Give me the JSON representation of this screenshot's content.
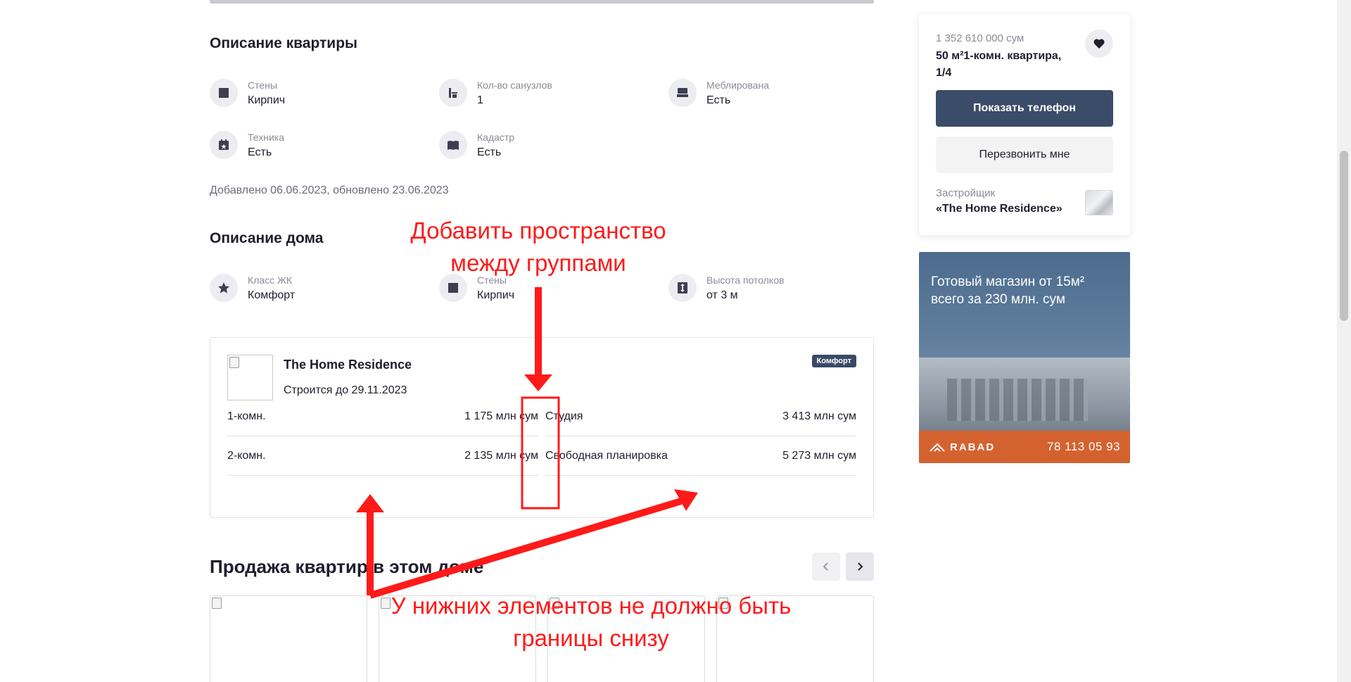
{
  "apartment": {
    "title": "Описание квартиры",
    "features": [
      {
        "label": "Стены",
        "value": "Кирпич",
        "icon": "wall-icon"
      },
      {
        "label": "Кол-во санузлов",
        "value": "1",
        "icon": "bathroom-icon"
      },
      {
        "label": "Меблирована",
        "value": "Есть",
        "icon": "sofa-icon"
      },
      {
        "label": "Техника",
        "value": "Есть",
        "icon": "calendar-star-icon"
      },
      {
        "label": "Кадастр",
        "value": "Есть",
        "icon": "book-icon"
      }
    ],
    "added": "Добавлено 06.06.2023, обновлено 23.06.2023"
  },
  "house": {
    "title": "Описание дома",
    "features": [
      {
        "label": "Класс ЖК",
        "value": "Комфорт",
        "icon": "star-icon"
      },
      {
        "label": "Стены",
        "value": "Кирпич",
        "icon": "wall-icon"
      },
      {
        "label": "Высота потолков",
        "value": "от 3 м",
        "icon": "ceiling-height-icon"
      }
    ]
  },
  "complex": {
    "name": "The Home Residence",
    "status": "Строится до 29.11.2023",
    "badge": "Комфорт",
    "prices_left": [
      {
        "type": "1-комн.",
        "price": "1 175 млн сум"
      },
      {
        "type": "2-комн.",
        "price": "2 135 млн сум"
      }
    ],
    "prices_right": [
      {
        "type": "Студия",
        "price": "3 413 млн сум"
      },
      {
        "type": "Свободная планировка",
        "price": "5 273 млн сум"
      }
    ]
  },
  "sales": {
    "title": "Продажа квартир в этом доме"
  },
  "sidebar": {
    "price": "1 352 610 000 сум",
    "description": "50 м²1-комн. квартира, 1/4",
    "show_phone": "Показать телефон",
    "call_me": "Перезвонить мне",
    "developer_label": "Застройщик",
    "developer_name": "«The Home Residence»"
  },
  "ad": {
    "headline": "Готовый магазин от 15м² всего за 230 млн. сум",
    "brand": "RABAD",
    "phone": "78 113 05 93"
  },
  "annotations": {
    "space_note_1": "Добавить пространство",
    "space_note_2": "между группами",
    "border_note_1": "У нижних элементов не должно быть",
    "border_note_2": "границы снизу"
  },
  "colors": {
    "accent": "#3a4c68",
    "annotation": "#ff1a1a",
    "ad_footer": "#d4622f"
  }
}
